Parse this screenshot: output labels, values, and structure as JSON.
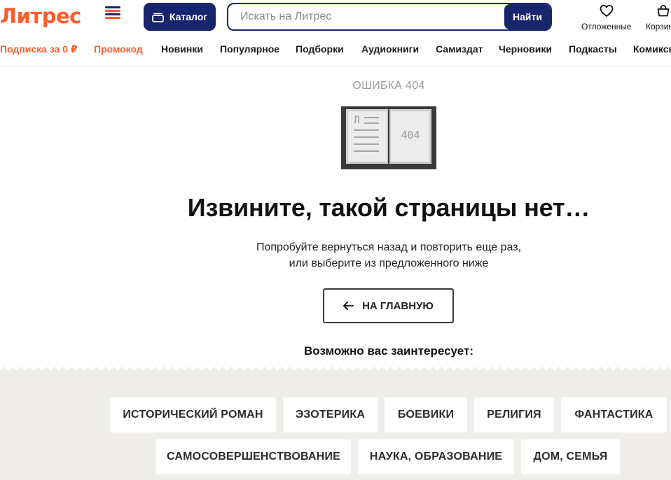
{
  "header": {
    "logo_text": "Литрес",
    "catalog_label": "Каталог",
    "search": {
      "placeholder": "Искать на Литрес",
      "value": "",
      "button_label": "Найти"
    },
    "user_menu": {
      "favorites_label": "Отложенные",
      "cart_label": "Корзина"
    },
    "colors": {
      "brand_orange": "#ff5c2b",
      "brand_navy": "#18246b"
    }
  },
  "nav": {
    "items": [
      {
        "label": "Подписка за 0 ₽",
        "accent": true
      },
      {
        "label": "Промокод",
        "accent": true
      },
      {
        "label": "Новинки"
      },
      {
        "label": "Популярное"
      },
      {
        "label": "Подборки"
      },
      {
        "label": "Аудиокниги"
      },
      {
        "label": "Самиздат"
      },
      {
        "label": "Черновики"
      },
      {
        "label": "Подкасты"
      },
      {
        "label": "Комиксы"
      }
    ]
  },
  "error": {
    "code_label": "ОШИБКА 404",
    "book_left_letter": "Л",
    "book_right_text": "404",
    "title": "Извините, такой страницы нет…",
    "subtitle_line1": "Попробуйте вернуться назад и повторить еще раз,",
    "subtitle_line2": "или выберите из предложенного ниже",
    "home_button_label": "НА ГЛАВНУЮ"
  },
  "suggestions": {
    "heading": "Возможно вас заинтересует:",
    "items": [
      "ИСТОРИЧЕСКИЙ РОМАН",
      "ЭЗОТЕРИКА",
      "БОЕВИКИ",
      "РЕЛИГИЯ",
      "ФАНТАСТИКА",
      "САМОСОВЕРШЕНСТВОВАНИЕ",
      "НАУКА, ОБРАЗОВАНИЕ",
      "ДОМ, СЕМЬЯ"
    ]
  }
}
